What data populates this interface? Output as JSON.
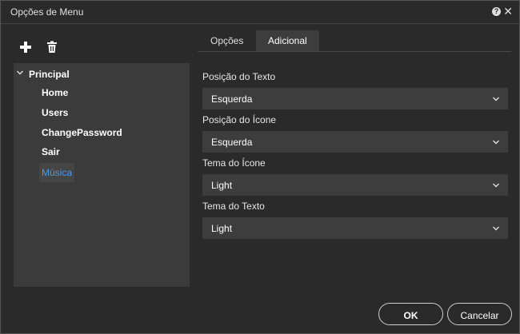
{
  "window": {
    "title": "Opções de Menu"
  },
  "tree": {
    "root_label": "Principal",
    "items": [
      {
        "label": "Home"
      },
      {
        "label": "Users"
      },
      {
        "label": "ChangePassword"
      },
      {
        "label": "Sair"
      },
      {
        "label": "Música",
        "selected": true
      }
    ]
  },
  "tabs": [
    {
      "label": "Opções",
      "active": false
    },
    {
      "label": "Adicional",
      "active": true
    }
  ],
  "fields": [
    {
      "label": "Posição do Texto",
      "value": "Esquerda"
    },
    {
      "label": "Posição do Ícone",
      "value": "Esquerda"
    },
    {
      "label": "Tema do Ícone",
      "value": "Light"
    },
    {
      "label": "Tema do Texto",
      "value": "Light"
    }
  ],
  "buttons": {
    "ok": "OK",
    "cancel": "Cancelar"
  },
  "colors": {
    "selected_item": "#4a9ce8",
    "panel": "#3b3b3b",
    "background": "#2a2a2a"
  }
}
